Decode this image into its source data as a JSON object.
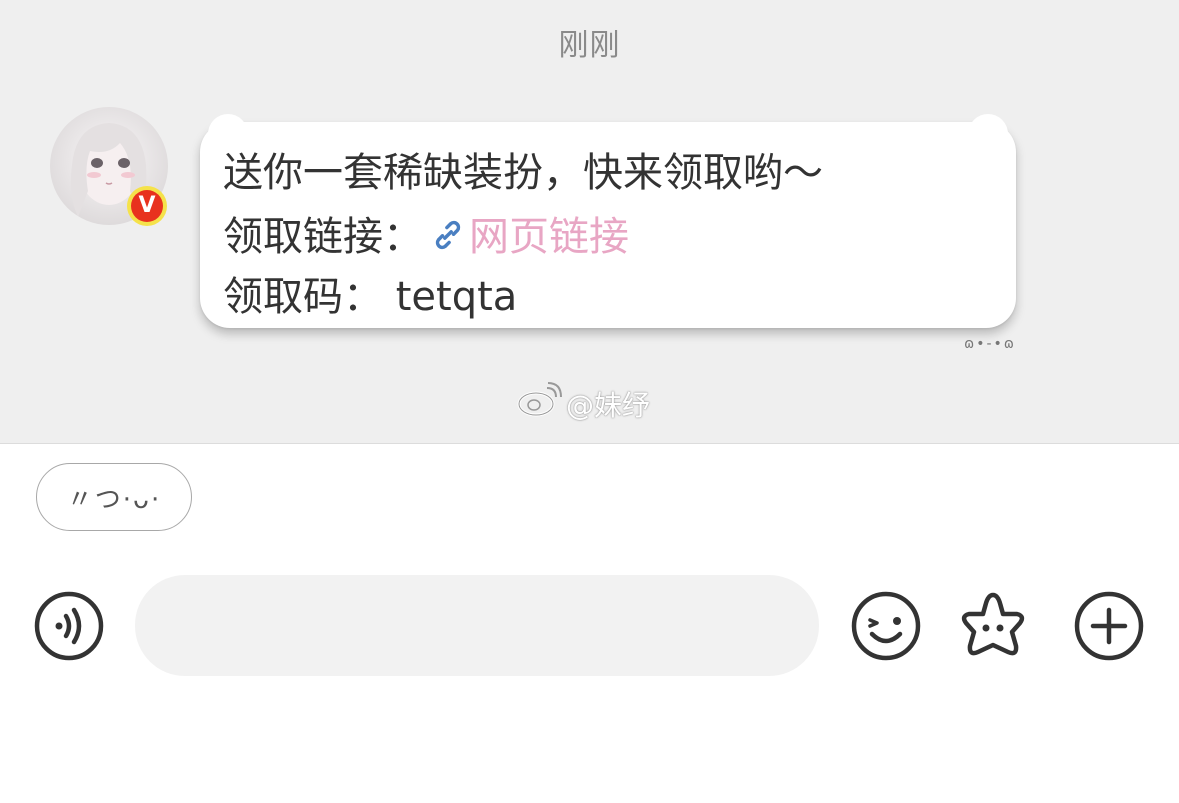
{
  "chat": {
    "timestamp": "刚刚",
    "message": {
      "line1": "送你一套稀缺装扮，快来领取哟～",
      "line2_prefix": "领取链接：",
      "line2_link": "网页链接",
      "line3": "领取码：  tetqta"
    },
    "bubble_decoration": "ɷ•-•ɷ",
    "verified_badge": "V"
  },
  "watermark": {
    "icon": "weibo-logo-icon",
    "text": "@妹纾"
  },
  "composer": {
    "quick_reply": "〃つ·ᴗ·",
    "input_value": "",
    "voice_icon": "voice-icon",
    "emoji_icon": "emoji-icon",
    "sticker_icon": "star-sticker-icon",
    "add_icon": "plus-circle-icon"
  },
  "colors": {
    "link": "#e8a6c4",
    "link_icon": "#4a7fc1",
    "badge_red": "#e8321e",
    "badge_yellow": "#f5e24a",
    "chat_bg": "#efefef"
  }
}
